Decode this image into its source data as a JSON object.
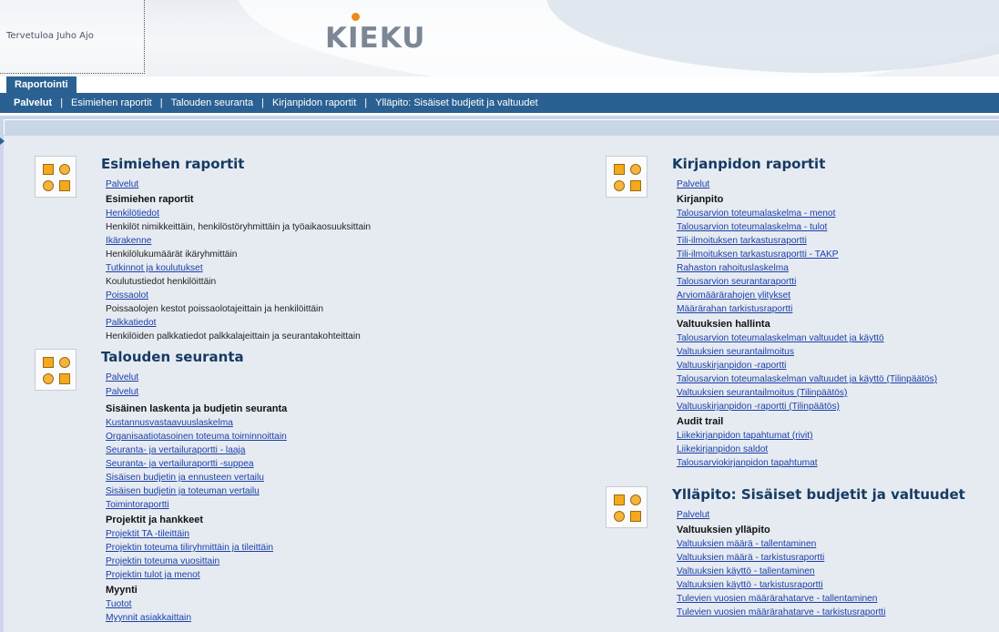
{
  "header": {
    "welcome": "Tervetuloa Juho Ajo",
    "logo": "KIEKU"
  },
  "tabs": [
    {
      "label": "Raportointi",
      "active": true
    }
  ],
  "nav": [
    {
      "label": "Palvelut",
      "active": true
    },
    {
      "label": "Esimiehen raportit",
      "active": false
    },
    {
      "label": "Talouden seuranta",
      "active": false
    },
    {
      "label": "Kirjanpidon raportit",
      "active": false
    },
    {
      "label": "Ylläpito: Sisäiset budjetit ja valtuudet",
      "active": false
    }
  ],
  "colors": {
    "nav_bg": "#2a6192",
    "content_bg": "#e6ebf2",
    "link": "#1b3fa6",
    "title": "#173a63",
    "icon_accent": "#f4a81d"
  },
  "sections": {
    "esimiehen": {
      "title": "Esimiehen raportit",
      "items": [
        {
          "type": "link",
          "text": "Palvelut"
        },
        {
          "type": "head",
          "text": "Esimiehen raportit"
        },
        {
          "type": "link",
          "text": "Henkilötiedot"
        },
        {
          "type": "desc",
          "text": "Henkilöt nimikkeittäin, henkilöstöryhmittäin ja työaikaosuuksittain"
        },
        {
          "type": "link",
          "text": "Ikärakenne"
        },
        {
          "type": "desc",
          "text": "Henkilölukumäärät ikäryhmittäin"
        },
        {
          "type": "link",
          "text": "Tutkinnot ja koulutukset"
        },
        {
          "type": "desc",
          "text": "Koulutustiedot henkilöittäin"
        },
        {
          "type": "link",
          "text": "Poissaolot"
        },
        {
          "type": "desc",
          "text": "Poissaolojen kestot poissaolotajeittain ja henkilöittäin"
        },
        {
          "type": "link",
          "text": "Palkkatiedot"
        },
        {
          "type": "desc",
          "text": "Henkilöiden palkkatiedot palkkalajeittain ja seurantakohteittain"
        }
      ]
    },
    "talouden": {
      "title": "Talouden seuranta",
      "items": [
        {
          "type": "link",
          "text": "Palvelut"
        },
        {
          "type": "link",
          "text": "Palvelut",
          "gap": true
        },
        {
          "type": "head",
          "text": "Sisäinen laskenta ja budjetin seuranta"
        },
        {
          "type": "link",
          "text": "Kustannusvastaavuuslaskelma"
        },
        {
          "type": "link",
          "text": "Organisaatiotasoinen toteuma toiminnoittain"
        },
        {
          "type": "link",
          "text": "Seuranta- ja vertailuraportti - laaja"
        },
        {
          "type": "link",
          "text": "Seuranta- ja vertailuraportti -suppea"
        },
        {
          "type": "link",
          "text": "Sisäisen budjetin ja ennusteen vertailu"
        },
        {
          "type": "link",
          "text": "Sisäisen budjetin ja toteuman vertailu"
        },
        {
          "type": "link",
          "text": "Toimintoraportti"
        },
        {
          "type": "head",
          "text": "Projektit ja hankkeet"
        },
        {
          "type": "link",
          "text": "Projektit TA -tileittäin"
        },
        {
          "type": "link",
          "text": "Projektin toteuma tiliryhmittäin ja tileittäin"
        },
        {
          "type": "link",
          "text": "Projektin toteuma vuosittain"
        },
        {
          "type": "link",
          "text": "Projektin tulot ja menot"
        },
        {
          "type": "head",
          "text": "Myynti"
        },
        {
          "type": "link",
          "text": "Tuotot"
        },
        {
          "type": "link",
          "text": "Myynnit asiakkaittain"
        }
      ]
    },
    "kirjanpidon": {
      "title": "Kirjanpidon raportit",
      "items": [
        {
          "type": "link",
          "text": "Palvelut"
        },
        {
          "type": "head",
          "text": "Kirjanpito"
        },
        {
          "type": "link",
          "text": "Talousarvion toteumalaskelma - menot"
        },
        {
          "type": "link",
          "text": "Talousarvion toteumalaskelma - tulot"
        },
        {
          "type": "link",
          "text": "Tili-ilmoituksen tarkastusraportti"
        },
        {
          "type": "link",
          "text": "Tili-ilmoituksen tarkastusraportti - TAKP"
        },
        {
          "type": "link",
          "text": "Rahaston rahoituslaskelma"
        },
        {
          "type": "link",
          "text": "Talousarvion seurantaraportti"
        },
        {
          "type": "link",
          "text": "Arviomäärärahojen ylitykset"
        },
        {
          "type": "link",
          "text": "Määrärahan tarkistusraportti"
        },
        {
          "type": "head",
          "text": "Valtuuksien hallinta"
        },
        {
          "type": "link",
          "text": "Talousarvion toteumalaskelman valtuudet ja käyttö"
        },
        {
          "type": "link",
          "text": "Valtuuksien seurantailmoitus"
        },
        {
          "type": "link",
          "text": "Valtuuskirjanpidon -raportti"
        },
        {
          "type": "link",
          "text": "Talousarvion toteumalaskelman valtuudet ja käyttö (Tilinpäätös)"
        },
        {
          "type": "link",
          "text": "Valtuuksien seurantailmoitus (Tilinpäätös)"
        },
        {
          "type": "link",
          "text": "Valtuuskirjanpidon -raportti (Tilinpäätös)"
        },
        {
          "type": "head",
          "text": "Audit trail"
        },
        {
          "type": "link",
          "text": "Liikekirjanpidon tapahtumat (rivit)"
        },
        {
          "type": "link",
          "text": "Liikekirjanpidon saldot"
        },
        {
          "type": "link",
          "text": "Talousarviokirjanpidon tapahtumat"
        }
      ]
    },
    "yllapito": {
      "title": "Ylläpito: Sisäiset budjetit ja valtuudet",
      "items": [
        {
          "type": "link",
          "text": "Palvelut"
        },
        {
          "type": "head",
          "text": "Valtuuksien ylläpito"
        },
        {
          "type": "link",
          "text": "Valtuuksien määrä - tallentaminen"
        },
        {
          "type": "link",
          "text": "Valtuuksien määrä -  tarkistusraportti"
        },
        {
          "type": "link",
          "text": "Valtuuksien käyttö - tallentaminen"
        },
        {
          "type": "link",
          "text": "Valtuuksien käyttö - tarkistusraportti"
        },
        {
          "type": "link",
          "text": "Tulevien vuosien määrärahatarve - tallentaminen"
        },
        {
          "type": "link",
          "text": "Tulevien vuosien määrärahatarve - tarkistusraportti"
        }
      ]
    }
  }
}
